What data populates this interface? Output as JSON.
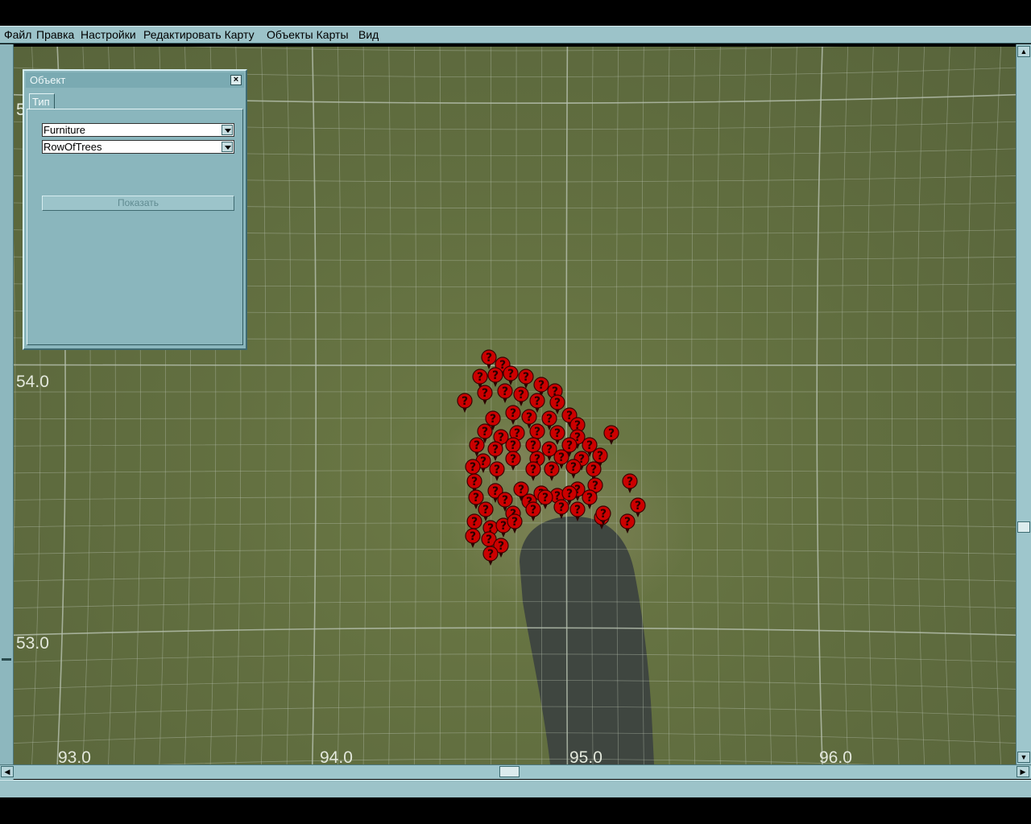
{
  "menu": {
    "items": [
      {
        "label": "Файл"
      },
      {
        "label": "Правка"
      },
      {
        "label": "Настройки"
      },
      {
        "label": "Редактировать Карту"
      },
      {
        "label": "Объекты Карты"
      },
      {
        "label": "Вид"
      }
    ]
  },
  "map": {
    "y_labels": [
      "54.0",
      "53.0"
    ],
    "x_labels": [
      "93.0",
      "94.0",
      "95.0",
      "96.0"
    ],
    "partial_label": "5",
    "marker_glyph": "?",
    "marker_icon": "red-question-marker-icon",
    "marker_color": "#cc0000",
    "grid_color": "#b8c2b0",
    "water_color": "#3f4640"
  },
  "dialog": {
    "title": "Объект",
    "close_icon": "close-x-icon",
    "tab_label": "Тип",
    "category_value": "Furniture",
    "subtype_value": "RowOfTrees",
    "show_button_label": "Показать"
  }
}
